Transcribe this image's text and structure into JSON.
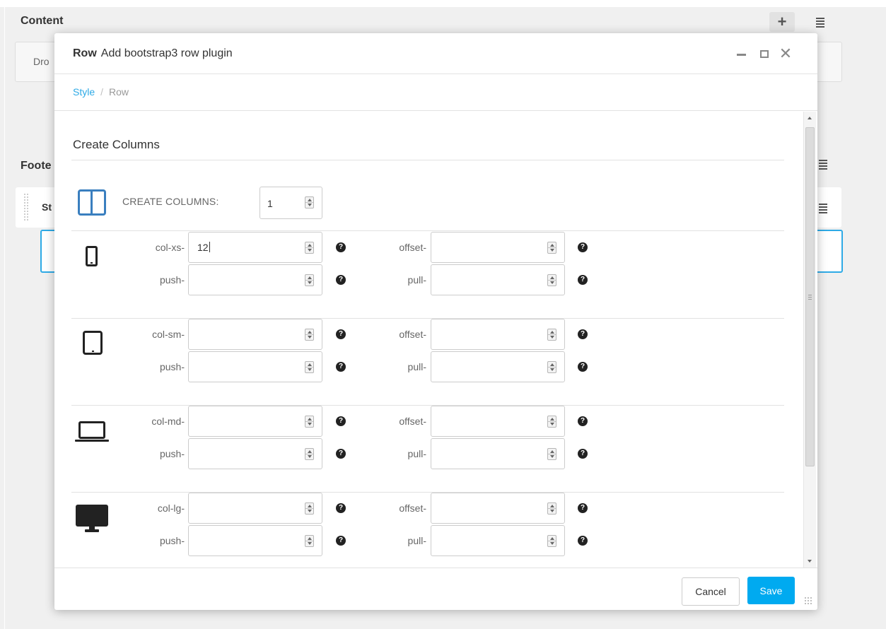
{
  "background": {
    "content_title": "Content",
    "dropzone_text": "Dro",
    "footer_title": "Foote",
    "plugin_label": "St"
  },
  "modal": {
    "title_bold": "Row",
    "title_text": "Add bootstrap3 row plugin",
    "breadcrumb": {
      "link": "Style",
      "separator": "/",
      "current": "Row"
    },
    "section_title": "Create Columns",
    "create_columns": {
      "label": "CREATE COLUMNS:",
      "value": "1"
    },
    "help_glyph": "?",
    "devices": [
      {
        "icon": "phone-icon",
        "col_label": "col-xs-",
        "col_value": "12",
        "offset_label": "offset-",
        "offset_value": "",
        "push_label": "push-",
        "push_value": "",
        "pull_label": "pull-",
        "pull_value": ""
      },
      {
        "icon": "tablet-icon",
        "col_label": "col-sm-",
        "col_value": "",
        "offset_label": "offset-",
        "offset_value": "",
        "push_label": "push-",
        "push_value": "",
        "pull_label": "pull-",
        "pull_value": ""
      },
      {
        "icon": "laptop-icon",
        "col_label": "col-md-",
        "col_value": "",
        "offset_label": "offset-",
        "offset_value": "",
        "push_label": "push-",
        "push_value": "",
        "pull_label": "pull-",
        "pull_value": ""
      },
      {
        "icon": "desktop-icon",
        "col_label": "col-lg-",
        "col_value": "",
        "offset_label": "offset-",
        "offset_value": "",
        "push_label": "push-",
        "push_value": "",
        "pull_label": "pull-",
        "pull_value": ""
      }
    ],
    "footer": {
      "cancel_label": "Cancel",
      "save_label": "Save"
    }
  },
  "colors": {
    "accent": "#2eaae6",
    "save_button": "#00aaf0",
    "columns_icon": "#3a7fbf"
  }
}
